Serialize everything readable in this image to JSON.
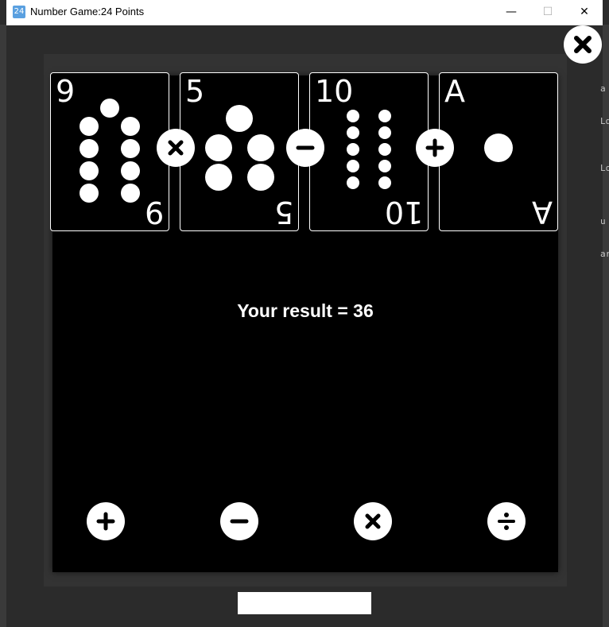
{
  "window": {
    "title": "Number Game:24 Points",
    "icon_label": "24",
    "minimize_glyph": "—",
    "maximize_glyph": "☐",
    "close_glyph": "✕"
  },
  "background_text": [
    "a",
    "Ld",
    "Lo",
    "u",
    "ar"
  ],
  "cards": [
    {
      "rank": "9",
      "pips": 9
    },
    {
      "rank": "5",
      "pips": 5
    },
    {
      "rank": "10",
      "pips": 10
    },
    {
      "rank": "A",
      "pips": 1
    }
  ],
  "between_ops": [
    "multiply-icon",
    "minus-icon",
    "plus-icon"
  ],
  "result_text": "Your result = 36",
  "operator_buttons": [
    "plus-icon",
    "minus-icon",
    "multiply-icon",
    "divide-icon"
  ],
  "colors": {
    "board": "#000000",
    "accent": "#ffffff",
    "background": "#2b2b2b"
  }
}
